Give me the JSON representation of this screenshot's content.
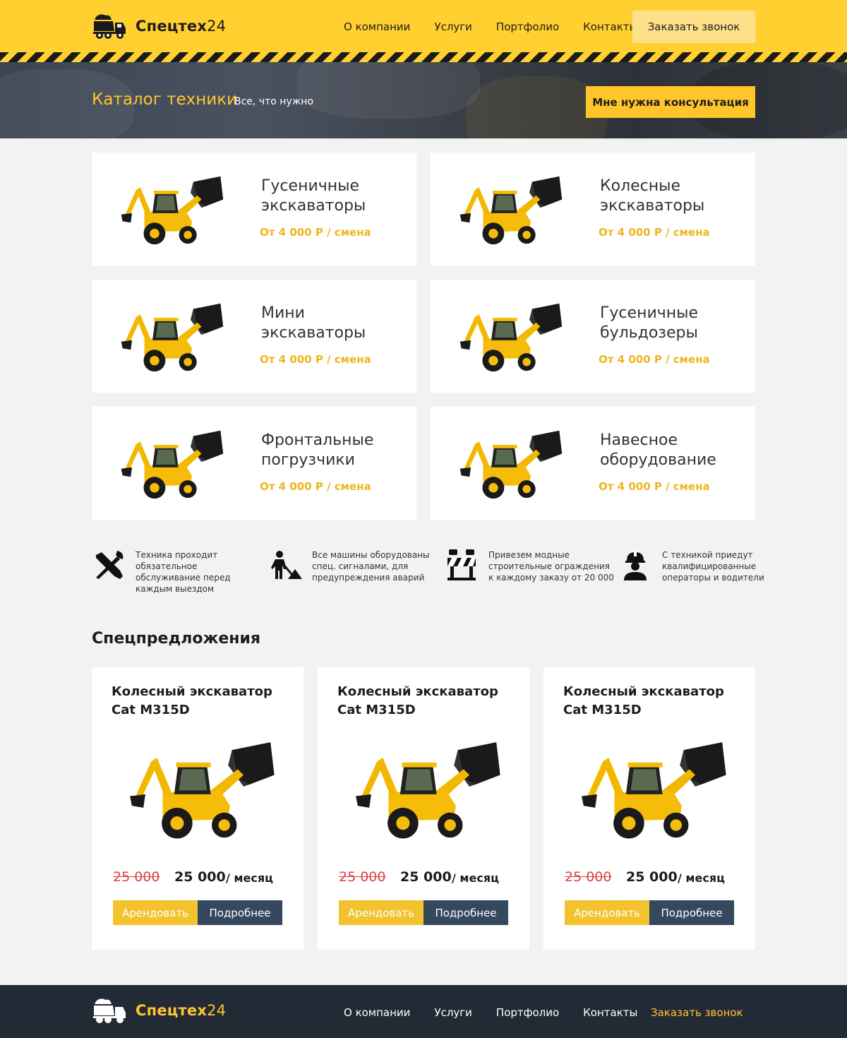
{
  "brand": {
    "name": "Спецтех",
    "num": "24"
  },
  "nav": [
    "О компании",
    "Услуги",
    "Портфолио",
    "Контакты"
  ],
  "header": {
    "call_button": "Заказать звонок"
  },
  "hero": {
    "title": "Каталог техники",
    "subtitle": "Все, что нужно",
    "button": "Мне нужна консультация"
  },
  "catalog": [
    {
      "title": "Гусеничные экскаваторы",
      "price": "От 4 000 Р / смена"
    },
    {
      "title": "Колесные экскаваторы",
      "price": "От 4 000 Р / смена"
    },
    {
      "title": "Мини экскаваторы",
      "price": "От 4 000 Р / смена"
    },
    {
      "title": "Гусеничные бульдозеры",
      "price": "От 4 000 Р / смена"
    },
    {
      "title": "Фронтальные погрузчики",
      "price": "От 4 000 Р / смена"
    },
    {
      "title": "Навесное оборудование",
      "price": "От 4 000 Р / смена"
    }
  ],
  "features": [
    {
      "icon": "tools-icon",
      "text": "Техника проходит обязательное обслуживание перед каждым выездом"
    },
    {
      "icon": "road-worker-icon",
      "text": "Все машины оборудованы спец. сигналами, для предупреждения аварий"
    },
    {
      "icon": "road-barrier-icon",
      "text": "Привезем модные строительные ограждения к каждому заказу от 20 000"
    },
    {
      "icon": "worker-helmet-icon",
      "text": "С техникой приедут квалифицированные операторы и водители"
    }
  ],
  "offers_title": "Спецпредложения",
  "offers": [
    {
      "name": "Колесный экскаватор Cat M315D",
      "old_price": "25 000",
      "price": "25 000",
      "period": "/ месяц",
      "rent": "Арендовать",
      "more": "Подробнее"
    },
    {
      "name": "Колесный экскаватор Cat M315D",
      "old_price": "25 000",
      "price": "25 000",
      "period": "/ месяц",
      "rent": "Арендовать",
      "more": "Подробнее"
    },
    {
      "name": "Колесный экскаватор Cat M315D",
      "old_price": "25 000",
      "price": "25 000",
      "period": "/ месяц",
      "rent": "Арендовать",
      "more": "Подробнее"
    }
  ],
  "footer": {
    "call": "Заказать звонок"
  },
  "colors": {
    "yellow": "#ffd02f",
    "accent": "#f0b51d",
    "dark": "#222a35",
    "button_dark": "#34495e",
    "old_price": "#e04141"
  }
}
